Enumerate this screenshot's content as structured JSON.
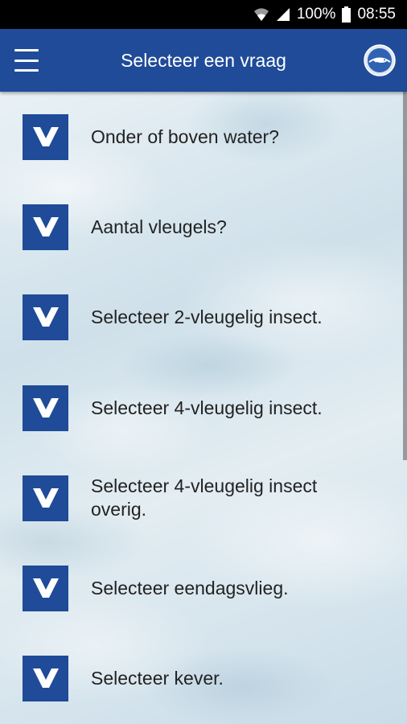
{
  "status_bar": {
    "battery_percent": "100%",
    "time": "08:55",
    "icons": [
      "wifi-icon",
      "signal-icon",
      "battery-icon"
    ]
  },
  "app_bar": {
    "title": "Selecteer een vraag",
    "menu_icon": "hamburger-menu-icon",
    "logo_icon": "app-logo-icon",
    "color": "#1f4b98"
  },
  "questions": [
    {
      "label": "Onder of boven water?",
      "icon": "v-badge-icon"
    },
    {
      "label": "Aantal vleugels?",
      "icon": "v-badge-icon"
    },
    {
      "label": "Selecteer 2-vleugelig insect.",
      "icon": "v-badge-icon"
    },
    {
      "label": "Selecteer 4-vleugelig insect.",
      "icon": "v-badge-icon"
    },
    {
      "label": "Selecteer 4-vleugelig insect overig.",
      "icon": "v-badge-icon"
    },
    {
      "label": "Selecteer eendagsvlieg.",
      "icon": "v-badge-icon"
    },
    {
      "label": "Selecteer kever.",
      "icon": "v-badge-icon"
    }
  ]
}
